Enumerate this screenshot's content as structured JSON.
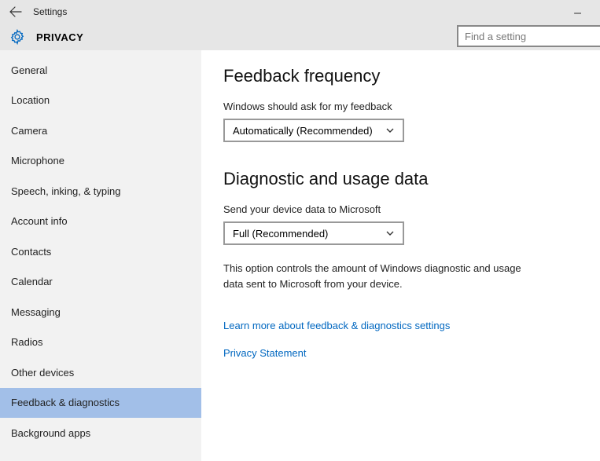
{
  "titlebar": {
    "title": "Settings"
  },
  "header": {
    "category": "PRIVACY",
    "search_placeholder": "Find a setting"
  },
  "sidebar": {
    "items": [
      {
        "label": "General"
      },
      {
        "label": "Location"
      },
      {
        "label": "Camera"
      },
      {
        "label": "Microphone"
      },
      {
        "label": "Speech, inking, & typing"
      },
      {
        "label": "Account info"
      },
      {
        "label": "Contacts"
      },
      {
        "label": "Calendar"
      },
      {
        "label": "Messaging"
      },
      {
        "label": "Radios"
      },
      {
        "label": "Other devices"
      },
      {
        "label": "Feedback & diagnostics"
      },
      {
        "label": "Background apps"
      }
    ],
    "selected_index": 11
  },
  "content": {
    "section1": {
      "heading": "Feedback frequency",
      "label": "Windows should ask for my feedback",
      "dropdown_value": "Automatically (Recommended)"
    },
    "section2": {
      "heading": "Diagnostic and usage data",
      "label": "Send your device data to Microsoft",
      "dropdown_value": "Full (Recommended)",
      "description": "This option controls the amount of Windows diagnostic and usage data sent to Microsoft from your device."
    },
    "links": {
      "learn_more": "Learn more about feedback & diagnostics settings",
      "privacy": "Privacy Statement"
    }
  }
}
